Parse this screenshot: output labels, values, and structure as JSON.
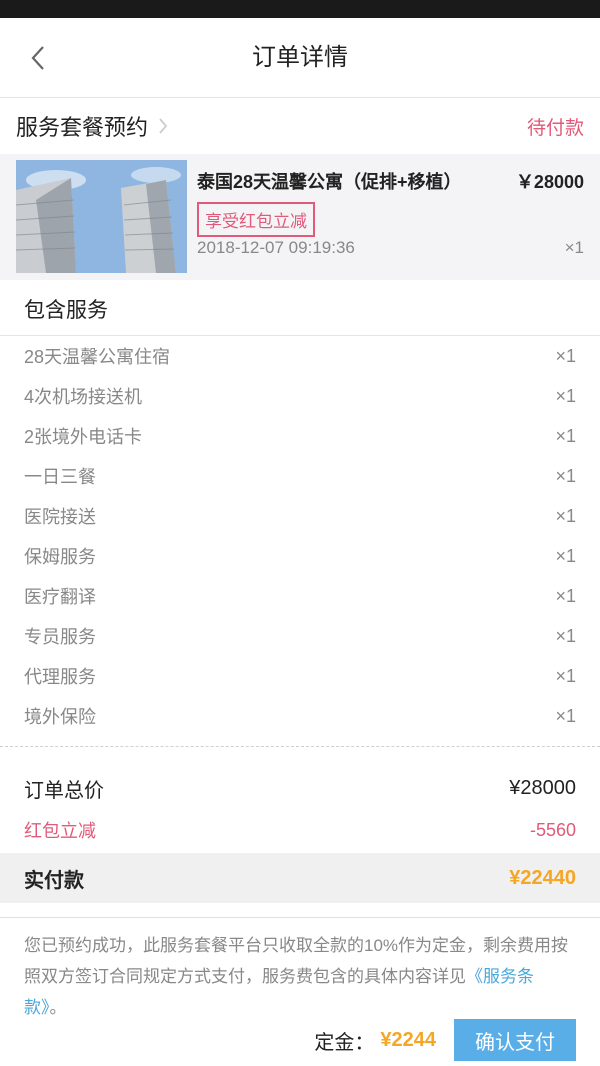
{
  "nav": {
    "title": "订单详情"
  },
  "package": {
    "title": "服务套餐预约",
    "status": "待付款"
  },
  "product": {
    "name": "泰国28天温馨公寓（促排+移植）",
    "price": "￥28000",
    "badge": "享受红包立减",
    "time": "2018-12-07 09:19:36",
    "qty": "×1"
  },
  "services": {
    "title": "包含服务",
    "items": [
      {
        "name": "28天温馨公寓住宿",
        "qty": "×1"
      },
      {
        "name": "4次机场接送机",
        "qty": "×1"
      },
      {
        "name": "2张境外电话卡",
        "qty": "×1"
      },
      {
        "name": "一日三餐",
        "qty": "×1"
      },
      {
        "name": "医院接送",
        "qty": "×1"
      },
      {
        "name": "保姆服务",
        "qty": "×1"
      },
      {
        "name": "医疗翻译",
        "qty": "×1"
      },
      {
        "name": "专员服务",
        "qty": "×1"
      },
      {
        "name": "代理服务",
        "qty": "×1"
      },
      {
        "name": "境外保险",
        "qty": "×1"
      }
    ]
  },
  "summary": {
    "total_label": "订单总价",
    "total_value": "¥28000",
    "discount_label": "红包立减",
    "discount_value": "-5560",
    "paid_label": "实付款",
    "paid_value": "¥22440"
  },
  "notice": {
    "text": "您已预约成功，此服务套餐平台只收取全款的10%作为定金，剩余费用按照双方签订合同规定方式支付，服务费包含的具体内容详见",
    "link": "《服务条款》",
    "tail": "。"
  },
  "footer": {
    "deposit_label": "定金：",
    "deposit_value": "¥2244",
    "confirm_label": "确认支付"
  },
  "colors": {
    "accent_pink": "#e05a7a",
    "price_orange": "#f5a623",
    "button_blue": "#5aaee8"
  }
}
